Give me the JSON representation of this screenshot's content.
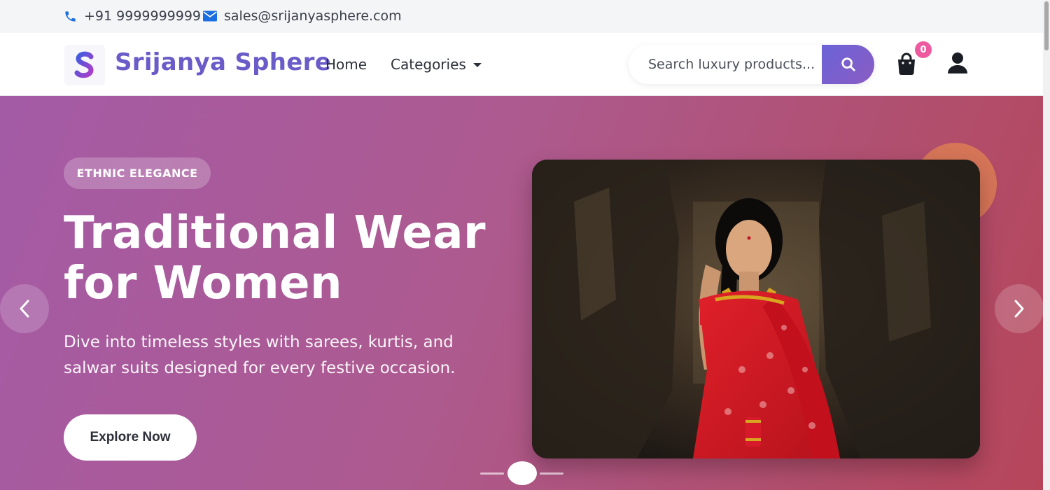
{
  "topbar": {
    "phone": "+91 9999999999",
    "email": "sales@srijanyasphere.com",
    "phone_icon": "phone-icon",
    "email_icon": "envelope-icon"
  },
  "nav": {
    "brand": "Srijanya Sphere",
    "logo_letter": "S",
    "links": [
      "Home",
      "Categories"
    ],
    "search_placeholder": "Search luxury products...",
    "cart_count": "0",
    "icons": [
      "search-icon",
      "shopping-bag-icon",
      "user-icon"
    ]
  },
  "hero": {
    "tag": "ETHNIC ELEGANCE",
    "headline_line1": "Traditional Wear",
    "headline_line2": "for Women",
    "subtitle": "Dive into timeless styles with sarees, kurtis, and salwar suits designed for every festive occasion.",
    "cta": "Explore Now",
    "image_subject": "woman in red embroidered saree with gold jewelry in a dark rustic corridor",
    "slide_count": 3,
    "active_slide": 2
  },
  "colors": {
    "brand": "#6a5cc8",
    "hero_gradient_start": "#a45ba6",
    "hero_gradient_end": "#b6455a",
    "badge": "#ee5aa0",
    "icon_blue": "#1b6fe0",
    "deco_orange": "#d97a56"
  }
}
